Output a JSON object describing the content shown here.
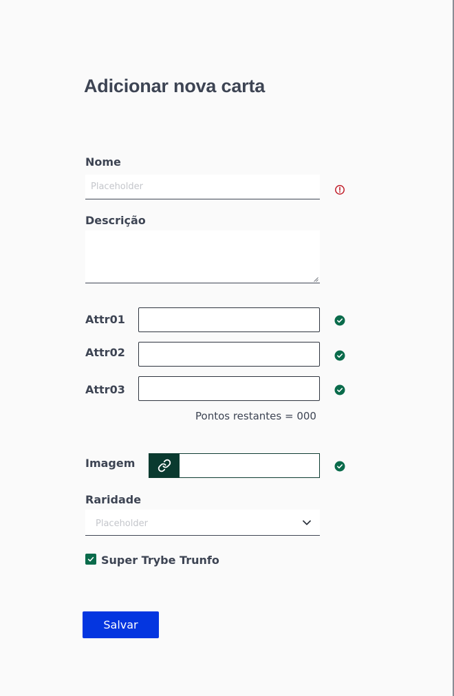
{
  "page": {
    "title": "Adicionar nova carta"
  },
  "form": {
    "name": {
      "label": "Nome",
      "placeholder": "Placeholder",
      "value": "",
      "status": "error"
    },
    "description": {
      "label": "Descrição",
      "value": ""
    },
    "attributes": [
      {
        "label": "Attr01",
        "value": "",
        "status": "valid"
      },
      {
        "label": "Attr02",
        "value": "",
        "status": "valid"
      },
      {
        "label": "Attr03",
        "value": "",
        "status": "valid"
      }
    ],
    "points_remaining": "Pontos restantes = 000",
    "image": {
      "label": "Imagem",
      "value": "",
      "icon": "link-icon",
      "status": "valid"
    },
    "rarity": {
      "label": "Raridade",
      "selected": "Placeholder"
    },
    "super_trunfo": {
      "label": "Super Trybe Trunfo",
      "checked": true
    },
    "save_label": "Salvar"
  },
  "colors": {
    "primary_button": "#0436e0",
    "valid": "#0a6b4b",
    "error": "#c01c28",
    "dark_green": "#0a3a2f",
    "text": "#3d4453"
  }
}
